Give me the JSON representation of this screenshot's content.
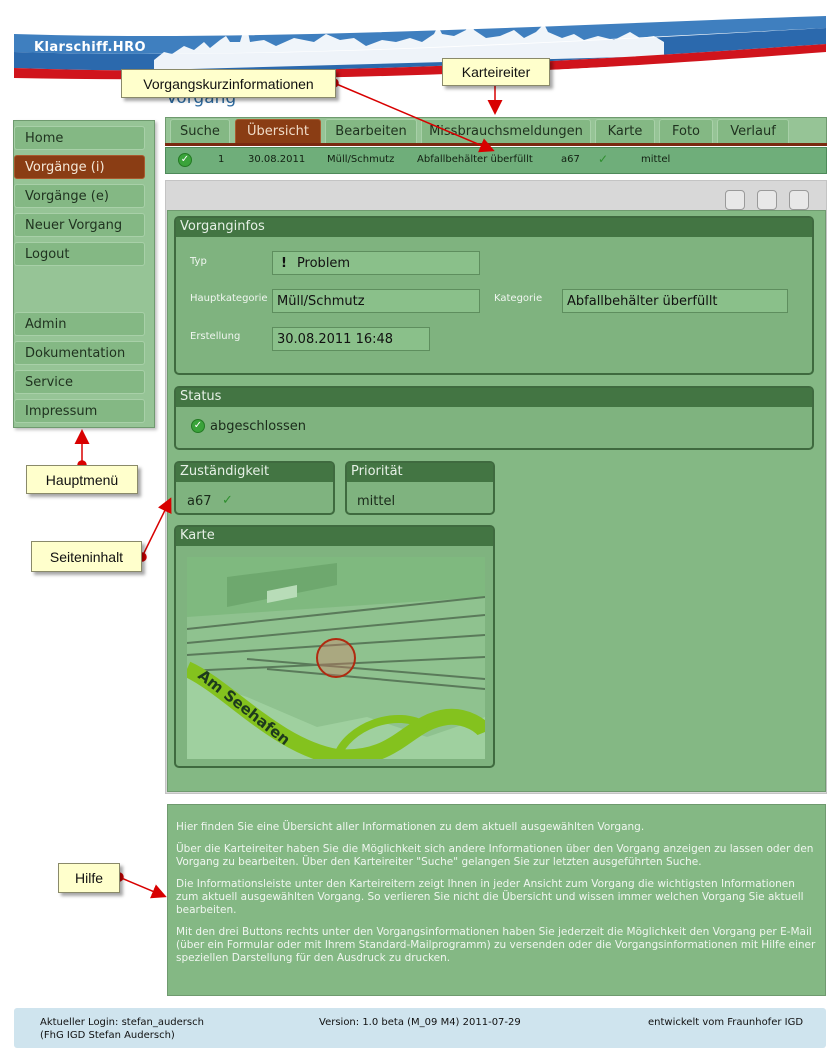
{
  "app": {
    "title": "Klarschiff.HRO"
  },
  "page": {
    "heading": "Vorgang"
  },
  "callouts": {
    "vorgangskurz": "Vorgangskurzinformationen",
    "karteireiter": "Karteireiter",
    "hauptmenue": "Hauptmenü",
    "seiteninhalt": "Seiteninhalt",
    "hilfe": "Hilfe"
  },
  "sidebar": {
    "items": [
      {
        "label": "Home"
      },
      {
        "label": "Vorgänge (i)",
        "active": true
      },
      {
        "label": "Vorgänge (e)"
      },
      {
        "label": "Neuer Vorgang"
      },
      {
        "label": "Logout"
      },
      {
        "label": "Admin"
      },
      {
        "label": "Dokumentation"
      },
      {
        "label": "Service"
      },
      {
        "label": "Impressum"
      }
    ]
  },
  "tabs": [
    {
      "label": "Suche"
    },
    {
      "label": "Übersicht",
      "active": true
    },
    {
      "label": "Bearbeiten"
    },
    {
      "label": "Missbrauchsmeldungen"
    },
    {
      "label": "Karte"
    },
    {
      "label": "Foto"
    },
    {
      "label": "Verlauf"
    }
  ],
  "infobar": {
    "id": "1",
    "date": "30.08.2011",
    "hauptkategorie": "Müll/Schmutz",
    "kategorie": "Abfallbehälter überfüllt",
    "zustaendigkeit": "a67",
    "prioritaet": "mittel"
  },
  "vorganginfos": {
    "title": "Vorganginfos",
    "typ_label": "Typ",
    "typ_icon": "!",
    "typ_value": "Problem",
    "hauptkategorie_label": "Hauptkategorie",
    "hauptkategorie_value": "Müll/Schmutz",
    "kategorie_label": "Kategorie",
    "kategorie_value": "Abfallbehälter überfüllt",
    "erstellung_label": "Erstellung",
    "erstellung_value": "30.08.2011 16:48"
  },
  "status": {
    "title": "Status",
    "value": "abgeschlossen"
  },
  "zustaendigkeit": {
    "title": "Zuständigkeit",
    "value": "a67"
  },
  "prioritaet": {
    "title": "Priorität",
    "value": "mittel"
  },
  "karte": {
    "title": "Karte",
    "street_label": "Am Seehafen"
  },
  "help": {
    "p1": "Hier finden Sie eine Übersicht aller Informationen zu dem aktuell ausgewählten Vorgang.",
    "p2": "Über die Karteireiter haben Sie die Möglichkeit sich andere Informationen über den Vorgang anzeigen zu lassen oder den Vorgang zu bearbeiten. Über den Karteireiter \"Suche\" gelangen Sie zur letzten ausgeführten Suche.",
    "p3": "Die Informationsleiste unter den Karteireitern zeigt Ihnen in jeder Ansicht zum Vorgang die wichtigsten Informationen zum aktuell ausgewählten Vorgang. So verlieren Sie nicht die Übersicht und wissen immer welchen Vorgang Sie aktuell bearbeiten.",
    "p4": "Mit den drei Buttons rechts unter den Vorgangsinformationen haben Sie jederzeit die Möglichkeit den Vorgang per E-Mail (über ein Formular oder mit Ihrem Standard-Mailprogramm) zu versenden oder die Vorgangsinformationen mit Hilfe einer speziellen Darstellung für den Ausdruck zu drucken."
  },
  "footer": {
    "login_line1": "Aktueller Login: stefan_audersch",
    "login_line2": "(FhG IGD Stefan Audersch)",
    "version": "Version: 1.0 beta (M_09 M4) 2011-07-29",
    "credit": "entwickelt vom Fraunhofer IGD"
  },
  "colors": {
    "accent_active": "#8a3d14",
    "panel_green": "#84b884",
    "panel_head": "#437543",
    "callout_yellow": "#ffffcc",
    "arrow_red": "#d80000"
  }
}
